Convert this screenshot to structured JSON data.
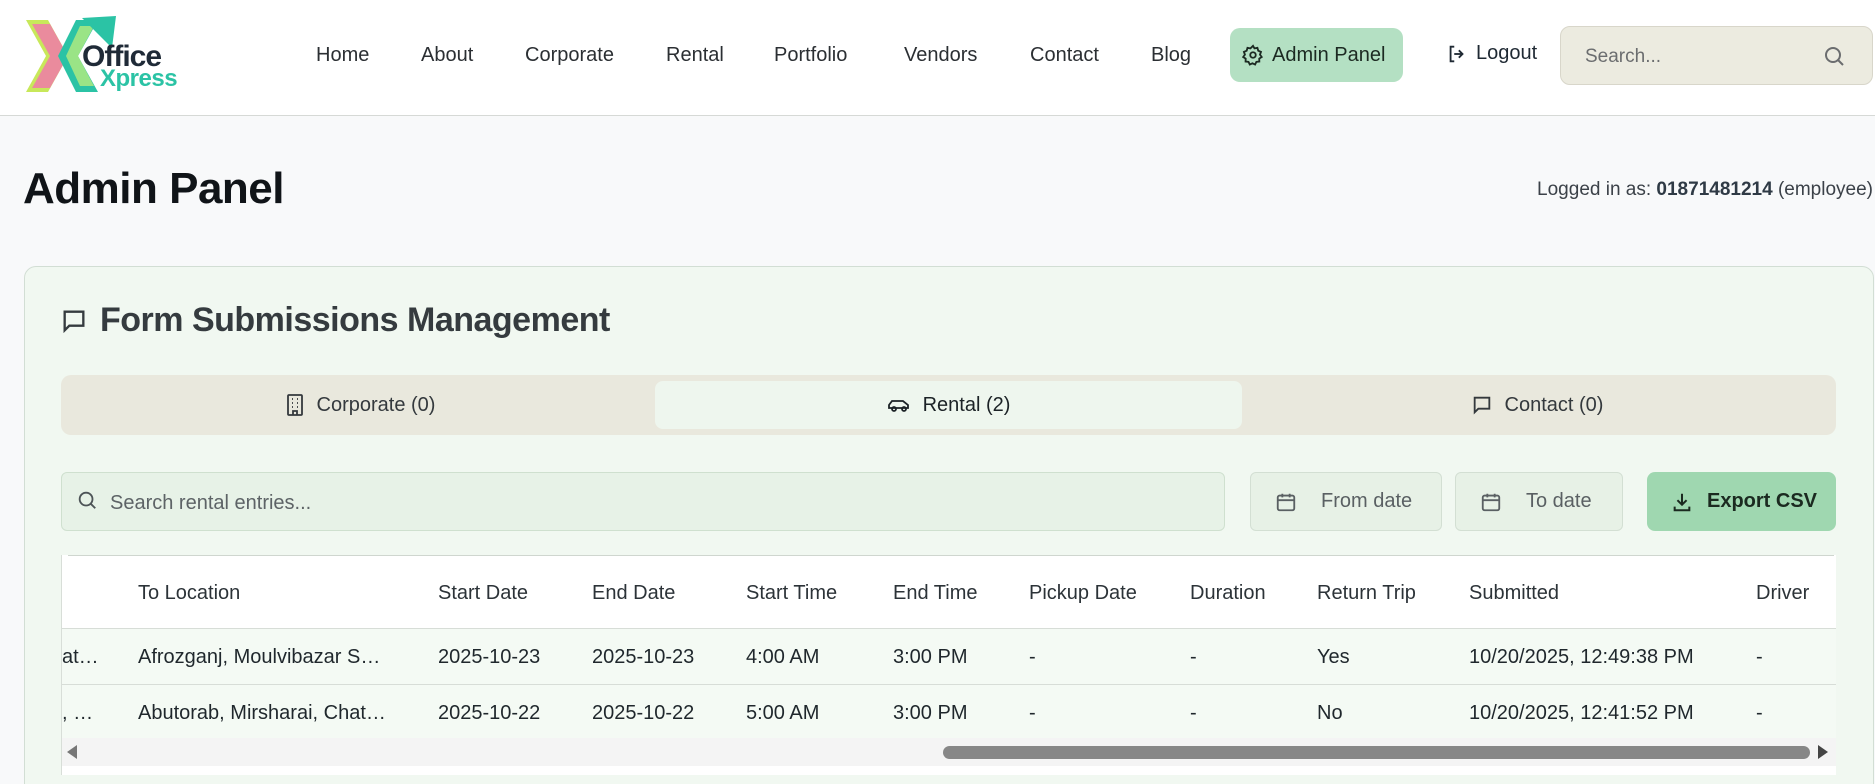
{
  "brand": {
    "line1": "Office",
    "line2": "Xpress",
    "accent": "#2bc3a5"
  },
  "nav": {
    "home": "Home",
    "about": "About",
    "corporate": "Corporate",
    "rental": "Rental",
    "portfolio": "Portfolio",
    "vendors": "Vendors",
    "contact": "Contact",
    "blog": "Blog",
    "admin_panel": "Admin Panel",
    "logout": "Logout"
  },
  "search": {
    "placeholder": "Search..."
  },
  "page": {
    "title": "Admin Panel",
    "logged_in_prefix": "Logged in as:",
    "user": "01871481214",
    "role": "(employee)"
  },
  "card": {
    "title": "Form Submissions Management",
    "tabs": [
      {
        "label": "Corporate (0)",
        "icon": "building-icon"
      },
      {
        "label": "Rental (2)",
        "icon": "car-icon",
        "active": true
      },
      {
        "label": "Contact (0)",
        "icon": "message-icon"
      }
    ],
    "search_placeholder": "Search rental entries...",
    "from_date": "From date",
    "to_date": "To date",
    "export": "Export CSV"
  },
  "table": {
    "columns": [
      "To Location",
      "Start Date",
      "End Date",
      "Start Time",
      "End Time",
      "Pickup Date",
      "Duration",
      "Return Trip",
      "Submitted",
      "Driver"
    ],
    "rows": [
      {
        "from": "at…",
        "to": "Afrozganj, Moulvibazar S…",
        "start_date": "2025-10-23",
        "end_date": "2025-10-23",
        "start_time": "4:00 AM",
        "end_time": "3:00 PM",
        "pickup": "-",
        "duration": "-",
        "return": "Yes",
        "submitted": "10/20/2025, 12:49:38 PM",
        "driver": "-"
      },
      {
        "from": ", …",
        "to": "Abutorab, Mirsharai, Chat…",
        "start_date": "2025-10-22",
        "end_date": "2025-10-22",
        "start_time": "5:00 AM",
        "end_time": "3:00 PM",
        "pickup": "-",
        "duration": "-",
        "return": "No",
        "submitted": "10/20/2025, 12:41:52 PM",
        "driver": "-"
      }
    ]
  }
}
